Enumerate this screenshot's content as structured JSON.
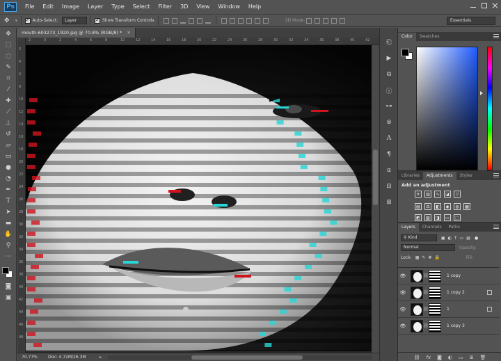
{
  "app": {
    "logo_text": "Ps"
  },
  "menu": [
    "File",
    "Edit",
    "Image",
    "Layer",
    "Type",
    "Select",
    "Filter",
    "3D",
    "View",
    "Window",
    "Help"
  ],
  "options_bar": {
    "auto_select_label": "Auto-Select:",
    "auto_select_target": "Layer",
    "show_transform_label": "Show Transform Controls",
    "mode_3d_label": "3D Mode:",
    "workspace": "Essentials"
  },
  "tools": [
    "move-tool",
    "marquee-tool",
    "lasso-tool",
    "quick-select-tool",
    "crop-tool",
    "eyedropper-tool",
    "healing-brush-tool",
    "brush-tool",
    "clone-stamp-tool",
    "history-brush-tool",
    "eraser-tool",
    "gradient-tool",
    "blur-tool",
    "dodge-tool",
    "pen-tool",
    "type-tool",
    "path-select-tool",
    "shape-tool",
    "hand-tool",
    "zoom-tool"
  ],
  "document": {
    "tab_title": "mouth-603273_1920.jpg @ 70.8% (RGB/8) *",
    "zoom": "70.77%",
    "doc_size": "Doc: 4.72M/26.3M",
    "ruler_top": [
      "2",
      "0",
      "2",
      "4",
      "6",
      "8",
      "10",
      "12",
      "14",
      "16",
      "18",
      "20",
      "22",
      "24",
      "26",
      "28",
      "30",
      "32",
      "34",
      "36",
      "38",
      "40",
      "42"
    ],
    "ruler_left": [
      "2",
      "4",
      "6",
      "8",
      "10",
      "12",
      "14",
      "16",
      "18",
      "20",
      "22",
      "24",
      "26",
      "28",
      "30",
      "32",
      "34",
      "36",
      "38",
      "40",
      "42",
      "44",
      "46",
      "48"
    ]
  },
  "panels": {
    "color_tabs": [
      "Color",
      "Swatches"
    ],
    "adjust_tabs": [
      "Libraries",
      "Adjustments",
      "Styles"
    ],
    "adjust_title": "Add an adjustment",
    "layers_tabs": [
      "Layers",
      "Channels",
      "Paths"
    ],
    "kind_filter": "Kind",
    "blend_mode": "Normal",
    "opacity_label": "Opacity:",
    "lock_label": "Lock:",
    "fill_label": "Fill:"
  },
  "layers": [
    {
      "name": "1 copy",
      "visible": true
    },
    {
      "name": "1 copy 2",
      "visible": true
    },
    {
      "name": "1",
      "visible": true
    },
    {
      "name": "1 copy 3",
      "visible": true
    }
  ],
  "colors": {
    "ui_bg": "#535353",
    "panel_dark": "#3a3a3a",
    "accent_blue": "#47a5e8",
    "glitch_red": "#d0141e",
    "glitch_cyan": "#27d6d6"
  }
}
